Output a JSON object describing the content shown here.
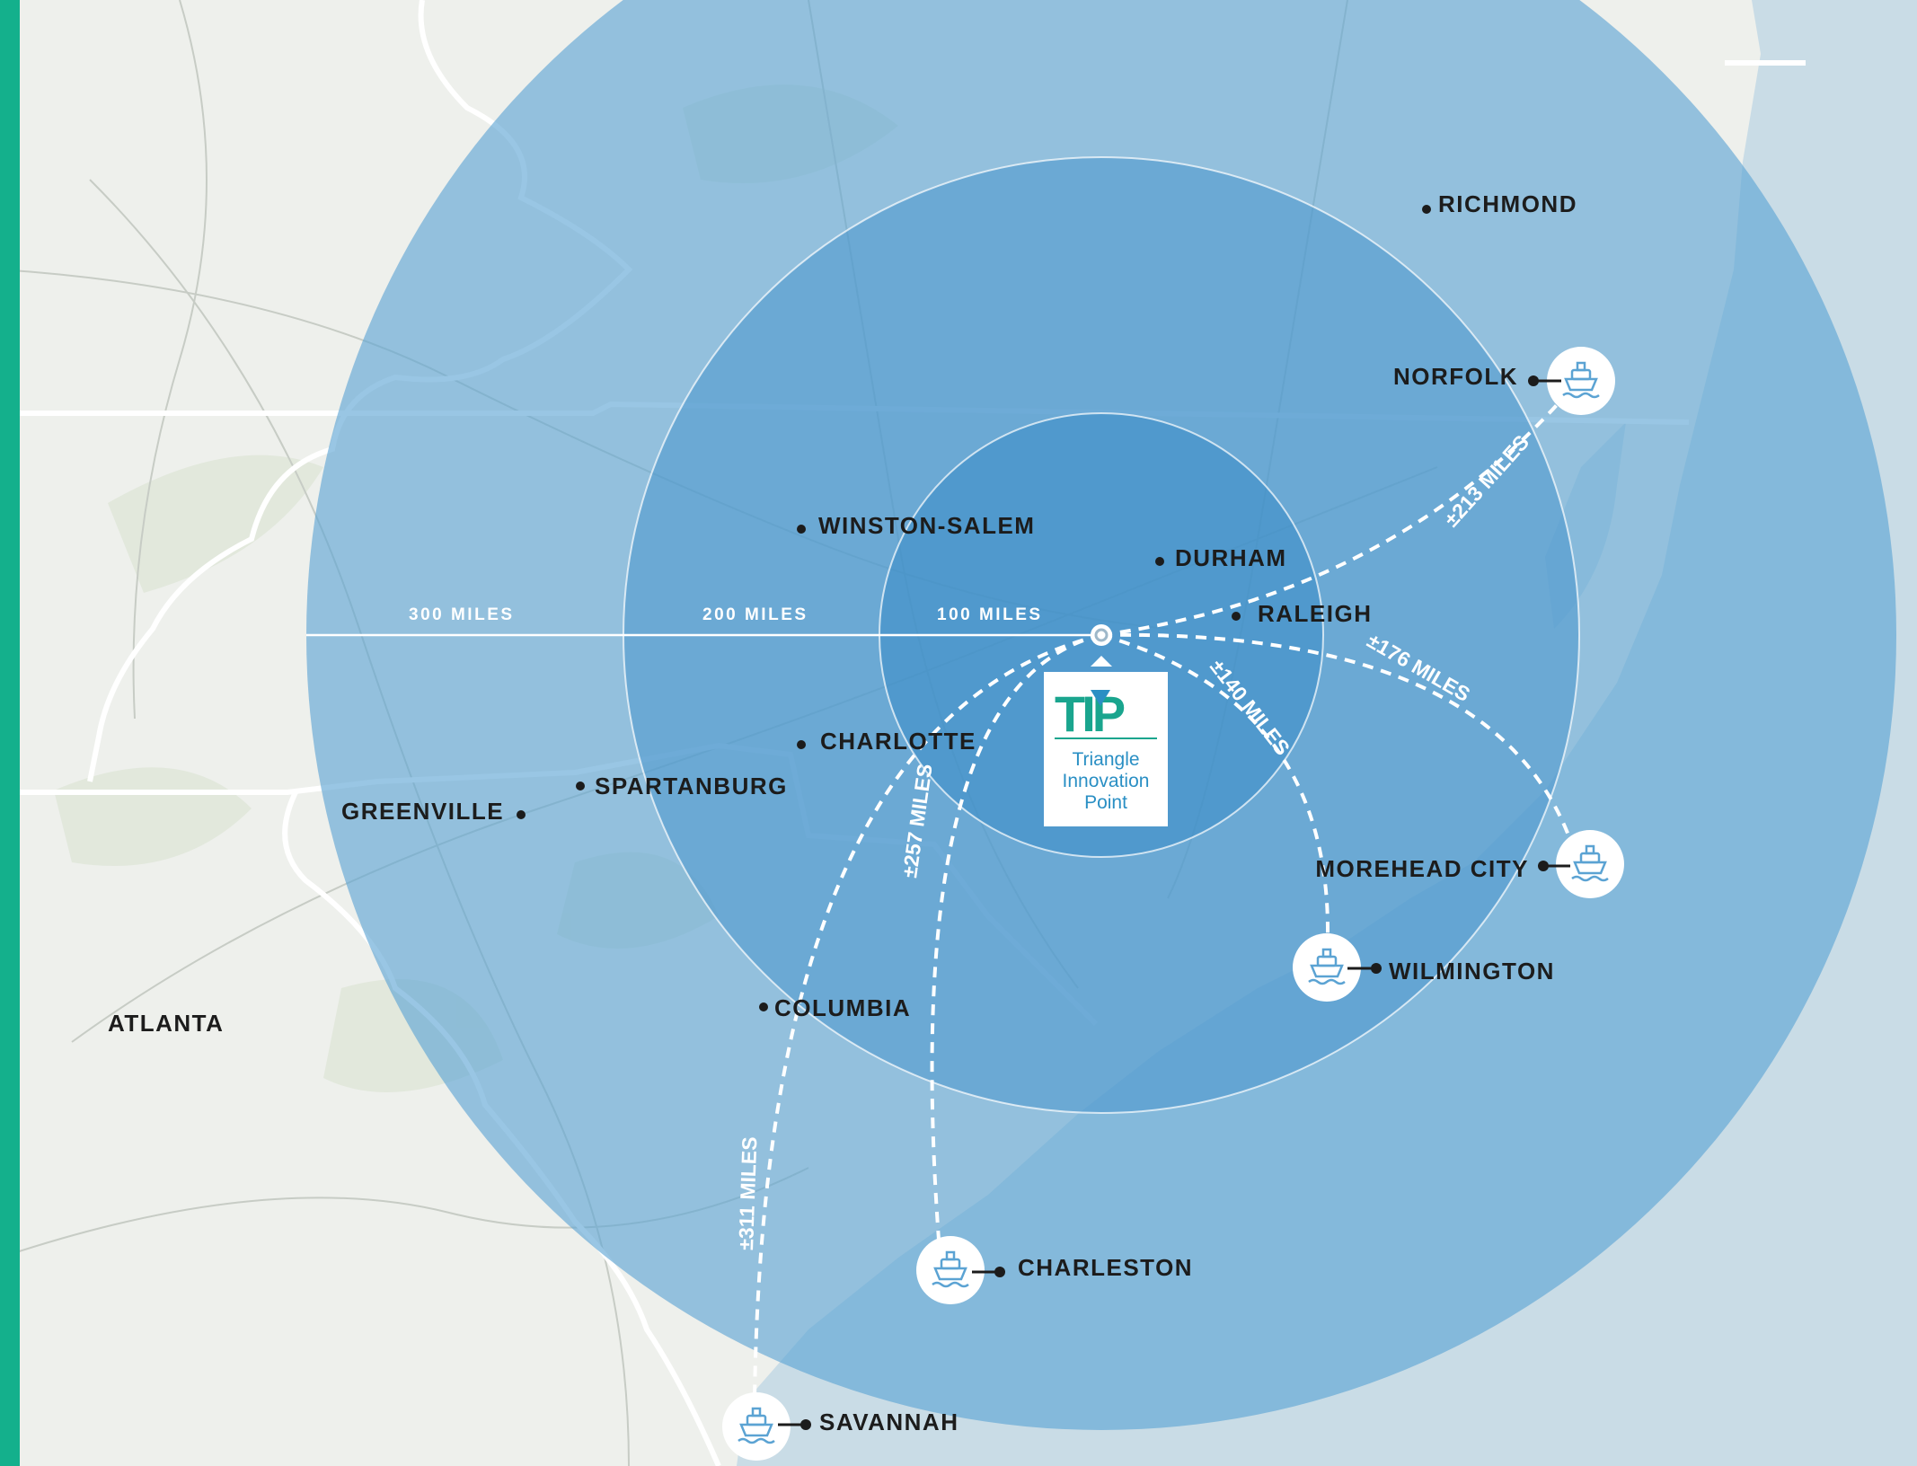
{
  "map": {
    "colors": {
      "land": "#eef0ec",
      "water": "#c9dce6",
      "accent_bar": "#14b08c",
      "ring_outer": "#5ba3d3",
      "ring_mid": "#4a96cc",
      "ring_inner": "#3a8cc6",
      "route": "#ffffff",
      "logo_green": "#1aa58e",
      "logo_blue": "#2a8fc4"
    },
    "radius_labels": [
      {
        "key": "r300",
        "text": "300 MILES"
      },
      {
        "key": "r200",
        "text": "200 MILES"
      },
      {
        "key": "r100",
        "text": "100 MILES"
      }
    ],
    "cities": [
      {
        "key": "richmond",
        "name": "RICHMOND"
      },
      {
        "key": "winston-salem",
        "name": "WINSTON-SALEM"
      },
      {
        "key": "durham",
        "name": "DURHAM"
      },
      {
        "key": "raleigh",
        "name": "RALEIGH"
      },
      {
        "key": "charlotte",
        "name": "CHARLOTTE"
      },
      {
        "key": "spartanburg",
        "name": "SPARTANBURG"
      },
      {
        "key": "greenville",
        "name": "GREENVILLE"
      },
      {
        "key": "columbia",
        "name": "COLUMBIA"
      },
      {
        "key": "atlanta",
        "name": "ATLANTA"
      }
    ],
    "ports": [
      {
        "key": "norfolk",
        "name": "NORFOLK",
        "distance": "±213 MILES",
        "icon": "ship-icon"
      },
      {
        "key": "morehead-city",
        "name": "MOREHEAD CITY",
        "distance": "±176 MILES",
        "icon": "ship-icon"
      },
      {
        "key": "wilmington",
        "name": "WILMINGTON",
        "distance": "±140 MILES",
        "icon": "ship-icon"
      },
      {
        "key": "charleston",
        "name": "CHARLESTON",
        "distance": "±257 MILES",
        "icon": "ship-icon"
      },
      {
        "key": "savannah",
        "name": "SAVANNAH",
        "distance": "±311 MILES",
        "icon": "ship-icon"
      }
    ],
    "logo": {
      "mark": "TIP",
      "line1": "Triangle",
      "line2": "Innovation",
      "line3": "Point"
    }
  }
}
